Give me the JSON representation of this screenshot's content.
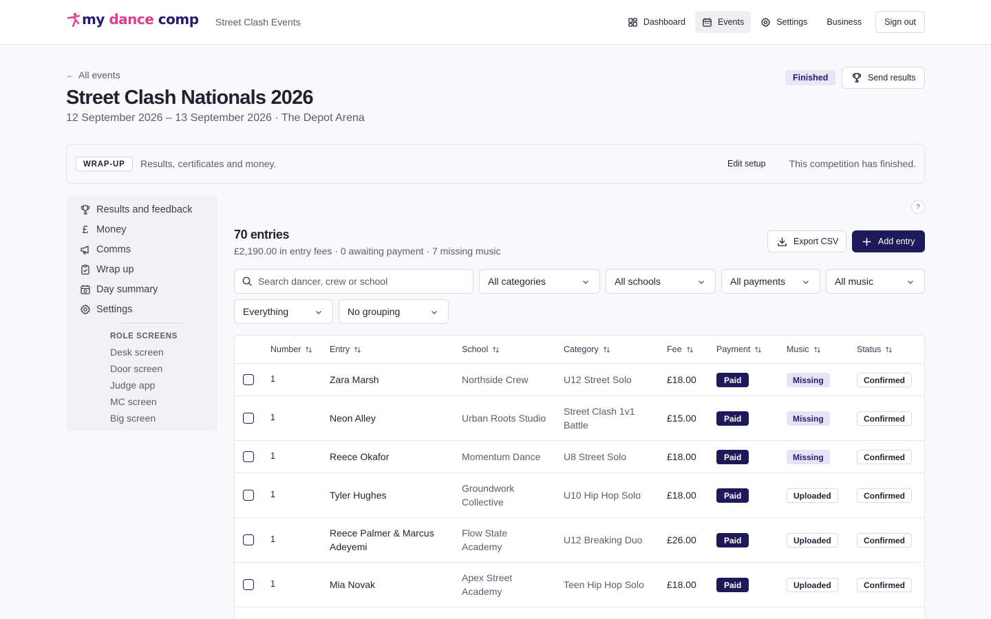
{
  "header": {
    "logo_part1": "my ",
    "logo_part2": "dance",
    "logo_part3": " comp",
    "org_name": "Street Clash Events",
    "nav": {
      "dashboard": "Dashboard",
      "events": "Events",
      "settings": "Settings",
      "business": "Business",
      "sign_out": "Sign out"
    }
  },
  "page": {
    "back_label": "All events",
    "title": "Street Clash Nationals 2026",
    "subtitle": "12 September 2026 – 13 September 2026 · The Depot Arena",
    "status_badge": "Finished",
    "send_results_label": "Send results"
  },
  "banner": {
    "tag": "WRAP-UP",
    "text": "Results, certificates and money.",
    "edit_label": "Edit setup",
    "status_text": "This competition has finished."
  },
  "sidebar": {
    "items": [
      {
        "label": "Results and feedback",
        "icon": "trophy-icon"
      },
      {
        "label": "Money",
        "icon": "pound-icon"
      },
      {
        "label": "Comms",
        "icon": "megaphone-icon"
      },
      {
        "label": "Wrap up",
        "icon": "clipboard-icon"
      },
      {
        "label": "Day summary",
        "icon": "calendar-icon"
      },
      {
        "label": "Settings",
        "icon": "gear-icon"
      }
    ],
    "role_heading": "ROLE SCREENS",
    "role_screens": [
      "Desk screen",
      "Door screen",
      "Judge app",
      "MC screen",
      "Big screen"
    ]
  },
  "main": {
    "help_label": "?",
    "entries_title": "70 entries",
    "entries_summary": "£2,190.00 in entry fees · 0 awaiting payment · 7 missing music",
    "export_label": "Export CSV",
    "add_label": "Add entry",
    "search_placeholder": "Search dancer, crew or school",
    "filters": {
      "categories": "All categories",
      "schools": "All schools",
      "payments": "All payments",
      "music": "All music",
      "scope": "Everything",
      "grouping": "No grouping"
    }
  },
  "table": {
    "columns": [
      "Number",
      "Entry",
      "School",
      "Category",
      "Fee",
      "Payment",
      "Music",
      "Status"
    ],
    "rows": [
      {
        "number": "1",
        "entry": "Zara Marsh",
        "school": "Northside Crew",
        "category": "U12 Street Solo",
        "fee": "£18.00",
        "payment": "Paid",
        "music": "Missing",
        "status": "Confirmed"
      },
      {
        "number": "1",
        "entry": "Neon Alley",
        "school": "Urban Roots Studio",
        "category": "Street Clash 1v1 Battle",
        "fee": "£15.00",
        "payment": "Paid",
        "music": "Missing",
        "status": "Confirmed"
      },
      {
        "number": "1",
        "entry": "Reece Okafor",
        "school": "Momentum Dance",
        "category": "U8 Street Solo",
        "fee": "£18.00",
        "payment": "Paid",
        "music": "Missing",
        "status": "Confirmed"
      },
      {
        "number": "1",
        "entry": "Tyler Hughes",
        "school": "Groundwork Collective",
        "category": "U10 Hip Hop Solo",
        "fee": "£18.00",
        "payment": "Paid",
        "music": "Uploaded",
        "status": "Confirmed"
      },
      {
        "number": "1",
        "entry": "Reece Palmer & Marcus Adeyemi",
        "school": "Flow State Academy",
        "category": "U12 Breaking Duo",
        "fee": "£26.00",
        "payment": "Paid",
        "music": "Uploaded",
        "status": "Confirmed"
      },
      {
        "number": "1",
        "entry": "Mia Novak",
        "school": "Apex Street Academy",
        "category": "Teen Hip Hop Solo",
        "fee": "£18.00",
        "payment": "Paid",
        "music": "Uploaded",
        "status": "Confirmed"
      }
    ]
  },
  "colors": {
    "brand_navy": "#1e1a5a",
    "brand_pink": "#e23a8f",
    "missing_bg": "#e6e3f6"
  }
}
